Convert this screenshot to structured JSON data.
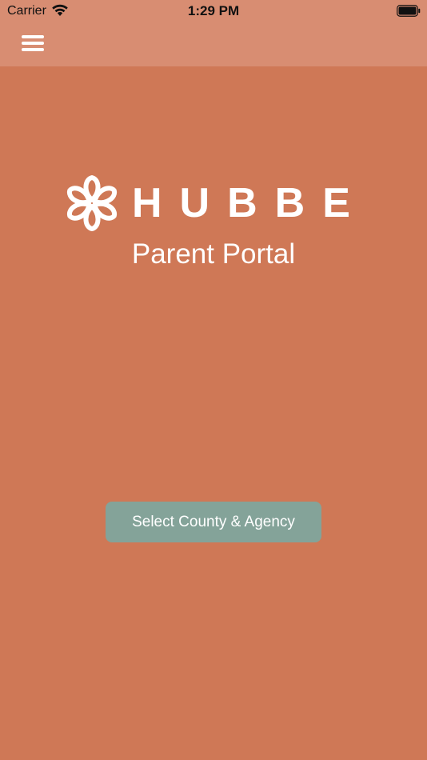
{
  "status_bar": {
    "carrier": "Carrier",
    "time": "1:29 PM",
    "icons": [
      "wifi-icon",
      "battery-icon"
    ]
  },
  "nav_bar": {
    "menu_icon": "hamburger-menu-icon"
  },
  "brand": {
    "logo_icon": "hubbe-flower-logo-icon",
    "wordmark": "HUBBE",
    "subtitle": "Parent Portal"
  },
  "actions": {
    "select_county_agency_label": "Select County & Agency"
  },
  "colors": {
    "background": "#CF7856",
    "nav_background": "#D88D72",
    "button_background": "#84A399",
    "text": "#FFFFFF"
  }
}
